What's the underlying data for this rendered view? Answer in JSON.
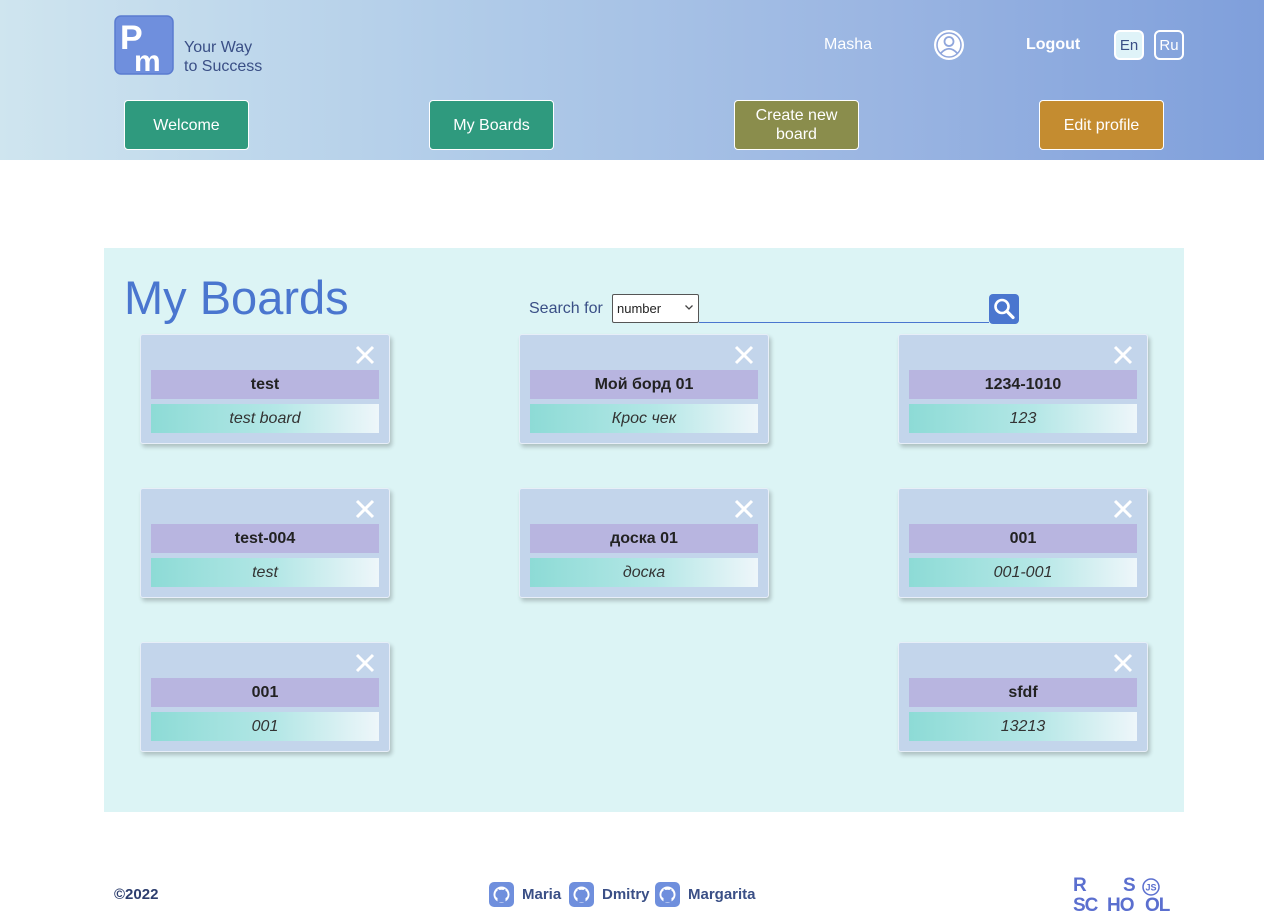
{
  "header": {
    "logo_text_line1": "Your Way",
    "logo_text_line2": "to Success",
    "user_name": "Masha",
    "logout_label": "Logout",
    "languages": [
      "En",
      "Ru"
    ],
    "active_language": "En",
    "nav": {
      "welcome": "Welcome",
      "my_boards": "My Boards",
      "create_board": "Create new board",
      "edit_profile": "Edit profile"
    }
  },
  "main": {
    "title": "My Boards",
    "search": {
      "label": "Search for",
      "selected_option": "number",
      "query": ""
    },
    "boards": [
      {
        "title": "test",
        "description": "test board"
      },
      {
        "title": "Мой борд 01",
        "description": "Крос чек"
      },
      {
        "title": "1234-1010",
        "description": "123"
      },
      {
        "title": "test-004",
        "description": "test"
      },
      {
        "title": "доска 01",
        "description": "доска"
      },
      {
        "title": "001",
        "description": "001-001"
      },
      {
        "title": "001",
        "description": "001"
      },
      {
        "title": "sfdf",
        "description": "13213"
      }
    ]
  },
  "footer": {
    "copyright": "©2022",
    "authors": [
      "Maria",
      "Dmitry",
      "Margarita"
    ]
  },
  "colors": {
    "accent_blue": "#4a76cf",
    "nav_green": "#2f9a7e",
    "nav_olive": "#8a8d4c",
    "nav_gold": "#c48c30",
    "panel_bg": "#dcf4f5"
  }
}
